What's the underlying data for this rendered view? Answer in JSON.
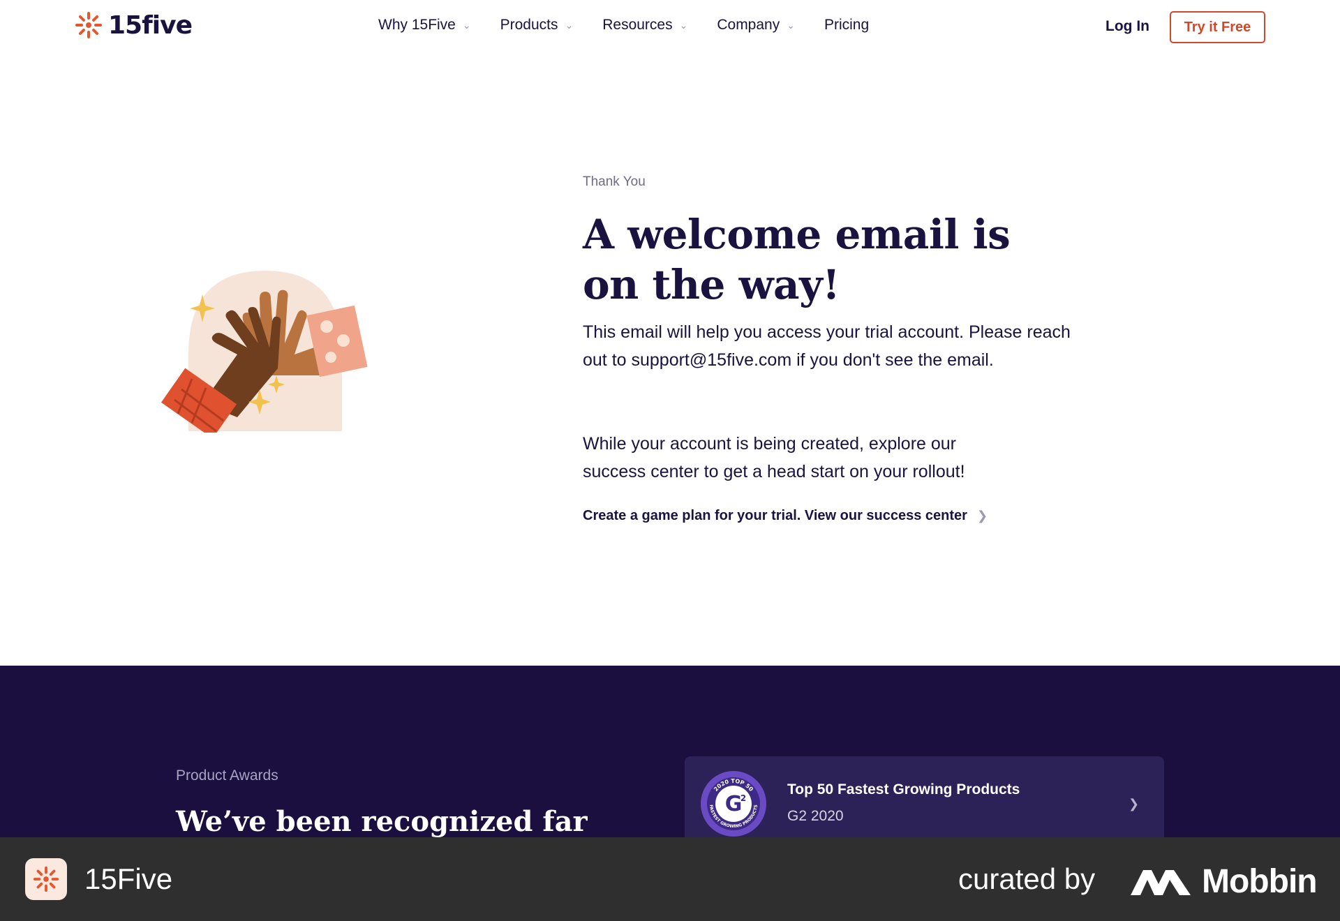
{
  "nav": {
    "logo_text": "15five",
    "items": [
      {
        "label": "Why 15Five",
        "has_dropdown": true
      },
      {
        "label": "Products",
        "has_dropdown": true
      },
      {
        "label": "Resources",
        "has_dropdown": true
      },
      {
        "label": "Company",
        "has_dropdown": true
      },
      {
        "label": "Pricing",
        "has_dropdown": false
      }
    ],
    "login_label": "Log In",
    "cta_label": "Try it Free"
  },
  "hero": {
    "eyebrow": "Thank You",
    "headline": "A welcome email is on the way!",
    "paragraph1": "This email will help you access your trial account. Please reach out to support@15five.com if you don't see the email.",
    "paragraph2": "While your account is being created, explore our success center to get a head start on your rollout!",
    "cta_link": "Create a game plan for your trial. View our success center",
    "illustration": "high-five-hands-illustration"
  },
  "awards": {
    "eyebrow": "Product Awards",
    "title": "We’ve been recognized far",
    "card": {
      "title": "Top 50 Fastest Growing Products",
      "subtitle": "G2 2020",
      "badge_icon": "g2-award-badge",
      "badge_top_text": "2020 TOP 50",
      "badge_bottom_text": "FASTEST GROWING PRODUCTS"
    }
  },
  "footer_bar": {
    "app_name": "15Five",
    "curated_by": "curated by",
    "brand": "Mobbin"
  },
  "colors": {
    "brand_orange": "#d2462a",
    "navy": "#1a1340",
    "band_bg": "#1a0f3e",
    "card_bg": "#2c2257"
  }
}
